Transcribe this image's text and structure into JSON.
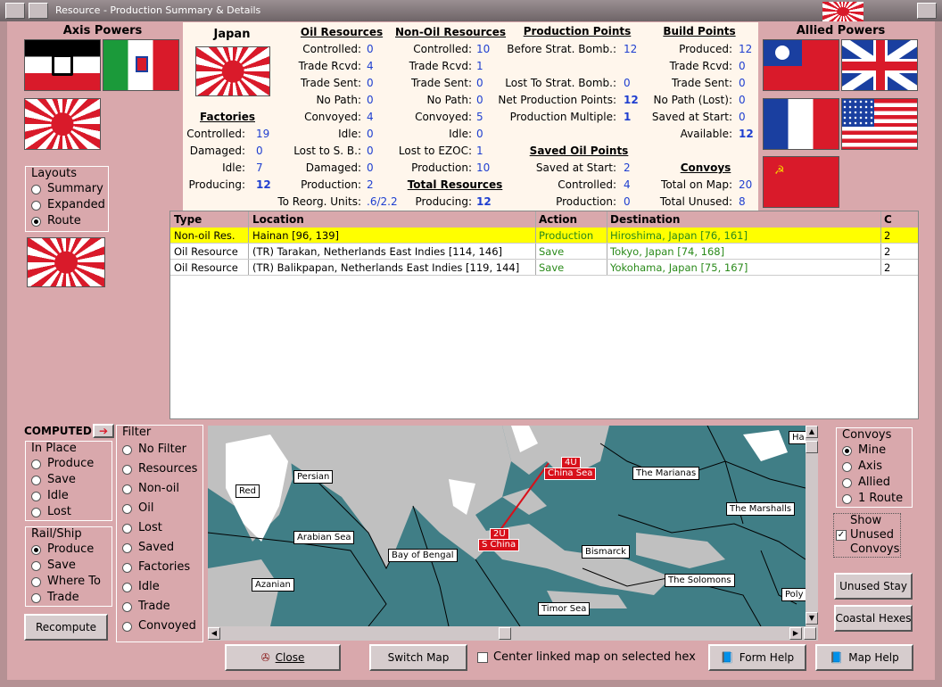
{
  "window": {
    "title": "Resource - Production Summary & Details"
  },
  "axis": {
    "title": "Axis Powers"
  },
  "allied": {
    "title": "Allied Powers"
  },
  "summary": {
    "country": "Japan",
    "factories": {
      "title": "Factories",
      "rows": [
        {
          "label": "Controlled:",
          "value": "19"
        },
        {
          "label": "Damaged:",
          "value": "0"
        },
        {
          "label": "Idle:",
          "value": "7"
        },
        {
          "label": "Producing:",
          "value": "12"
        }
      ]
    },
    "oil": {
      "title": "Oil Resources",
      "rows": [
        {
          "label": "Controlled:",
          "value": "0"
        },
        {
          "label": "Trade Rcvd:",
          "value": "4"
        },
        {
          "label": "Trade Sent:",
          "value": "0"
        },
        {
          "label": "No Path:",
          "value": "0"
        },
        {
          "label": "Convoyed:",
          "value": "4"
        },
        {
          "label": "Idle:",
          "value": "0"
        },
        {
          "label": "Lost to S. B.:",
          "value": "0"
        },
        {
          "label": "Damaged:",
          "value": "0"
        },
        {
          "label": "Production:",
          "value": "2"
        },
        {
          "label": "To Reorg. Units:",
          "value": ".6/2.2"
        }
      ]
    },
    "nonoil": {
      "title": "Non-Oil Resources",
      "rows": [
        {
          "label": "Controlled:",
          "value": "10"
        },
        {
          "label": "Trade Rcvd:",
          "value": "1"
        },
        {
          "label": "Trade Sent:",
          "value": "0"
        },
        {
          "label": "No Path:",
          "value": "0"
        },
        {
          "label": "Convoyed:",
          "value": "5"
        },
        {
          "label": "Idle:",
          "value": "0"
        },
        {
          "label": "Lost to EZOC:",
          "value": "1"
        },
        {
          "label": "Production:",
          "value": "10"
        }
      ]
    },
    "total": {
      "title": "Total Resources",
      "label": "Producing:",
      "value": "12"
    },
    "pp": {
      "title": "Production Points",
      "rows": [
        {
          "label": "Before Strat. Bomb.:",
          "value": "12"
        },
        {
          "label": "Lost To Strat. Bomb.:",
          "value": "0"
        },
        {
          "label": "Net Production Points:",
          "value": "12"
        },
        {
          "label": "Production Multiple:",
          "value": "1"
        }
      ]
    },
    "savedoil": {
      "title": "Saved Oil Points",
      "rows": [
        {
          "label": "Saved at Start:",
          "value": "2"
        },
        {
          "label": "Controlled:",
          "value": "4"
        },
        {
          "label": "Production:",
          "value": "0"
        }
      ]
    },
    "bp": {
      "title": "Build Points",
      "rows": [
        {
          "label": "Produced:",
          "value": "12"
        },
        {
          "label": "Trade Rcvd:",
          "value": "0"
        },
        {
          "label": "Trade Sent:",
          "value": "0"
        },
        {
          "label": "No Path (Lost):",
          "value": "0"
        },
        {
          "label": "Saved at Start:",
          "value": "0"
        },
        {
          "label": "Available:",
          "value": "12"
        }
      ]
    },
    "convoys": {
      "title": "Convoys",
      "rows": [
        {
          "label": "Total on Map:",
          "value": "20"
        },
        {
          "label": "Total Unused:",
          "value": "8"
        }
      ]
    }
  },
  "layouts": {
    "title": "Layouts",
    "options": [
      "Summary",
      "Expanded",
      "Route"
    ],
    "selected": "Route"
  },
  "table": {
    "headers": [
      "Type",
      "Location",
      "Action",
      "Destination",
      "C"
    ],
    "rows": [
      [
        "Non-oil Res.",
        "Hainan [96, 139]",
        "Production",
        "Hiroshima, Japan [76, 161]",
        "2"
      ],
      [
        "Oil Resource",
        "(TR) Tarakan, Netherlands East Indies [114, 146]",
        "Save",
        "Tokyo, Japan [74, 168]",
        "2"
      ],
      [
        "Oil Resource",
        "(TR) Balikpapan, Netherlands East Indies [119, 144]",
        "Save",
        "Yokohama, Japan [75, 167]",
        "2"
      ]
    ]
  },
  "computed": {
    "label": "COMPUTED"
  },
  "inplace": {
    "title": "In Place",
    "options": [
      "Produce",
      "Save",
      "Idle",
      "Lost"
    ]
  },
  "railship": {
    "title": "Rail/Ship",
    "options": [
      "Produce",
      "Save",
      "Where To",
      "Trade"
    ]
  },
  "filter": {
    "title": "Filter",
    "options": [
      "No Filter",
      "Resources",
      "Non-oil",
      "Oil",
      "Lost",
      "Saved",
      "Factories",
      "Idle",
      "Trade",
      "Convoyed"
    ]
  },
  "convoys_panel": {
    "title": "Convoys",
    "options": [
      "Mine",
      "Axis",
      "Allied",
      "1 Route"
    ],
    "selected": "Mine"
  },
  "show_unused": {
    "label1": "Show",
    "label2": "Unused",
    "label3": "Convoys"
  },
  "map": {
    "labels": [
      "Persian",
      "Red",
      "Arabian Sea",
      "Azanian",
      "Bay of Bengal",
      "China Sea",
      "S China",
      "The Marianas",
      "The Marshalls",
      "Bismarck",
      "The Solomons",
      "Timor Sea",
      "Ha",
      "Poly"
    ],
    "units": [
      "4U",
      "2U"
    ]
  },
  "buttons": {
    "recompute": "Recompute",
    "unused_stay": "Unused Stay",
    "coastal": "Coastal Hexes",
    "close": "Close",
    "switch_map": "Switch Map",
    "center": "Center linked map on selected hex",
    "form_help": "Form Help",
    "map_help": "Map Help"
  },
  "colors": {
    "accent": "#d9a8ac",
    "value_blue": "#1f3fd0",
    "highlight": "#ffff00",
    "sea": "#407e86"
  }
}
